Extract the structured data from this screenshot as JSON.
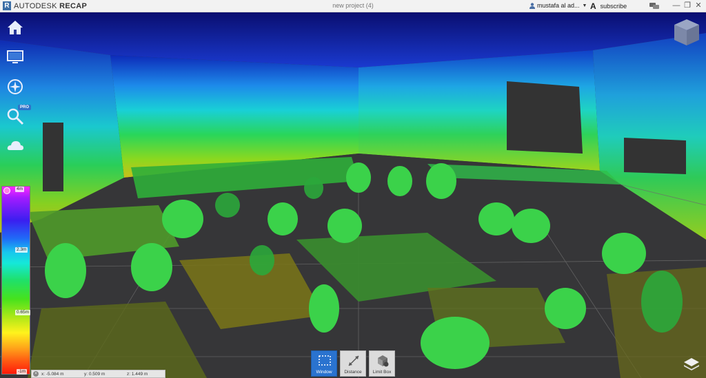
{
  "app": {
    "logo_mark": "R",
    "brand": "AUTODESK",
    "product": "RECAP",
    "project_title": "new project (4)",
    "user_name": "mustafa al ad...",
    "subscribe_label": "subscribe"
  },
  "nav": {
    "items": [
      {
        "name": "home",
        "icon": "home-icon"
      },
      {
        "name": "display",
        "icon": "monitor-icon"
      },
      {
        "name": "navigation",
        "icon": "compass-icon"
      },
      {
        "name": "search",
        "icon": "search-icon",
        "badge": "PRO"
      },
      {
        "name": "cloud",
        "icon": "cloud-icon"
      }
    ]
  },
  "legend": {
    "top": "4m",
    "mid1": "2.3m",
    "mid2": "0.65m",
    "bottom": "-1m"
  },
  "coords": {
    "x": "x:  -5.084  m",
    "y": "y:  0.509  m",
    "z": "z:  1.449  m"
  },
  "tools": [
    {
      "label": "Window",
      "icon": "window-select-icon",
      "active": true
    },
    {
      "label": "Distance",
      "icon": "distance-icon",
      "active": false
    },
    {
      "label": "Limit Box",
      "icon": "limit-box-icon",
      "active": false
    }
  ],
  "colors": {
    "accent": "#2a73cf",
    "titlebar": "#f2f2f2"
  }
}
